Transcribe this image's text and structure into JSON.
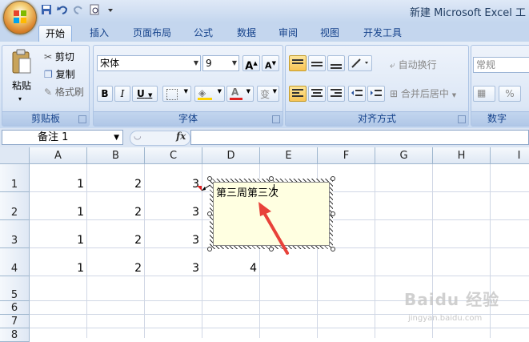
{
  "app": {
    "title": "新建 Microsoft Excel 工"
  },
  "tabs": [
    {
      "label": "开始",
      "active": true
    },
    {
      "label": "插入"
    },
    {
      "label": "页面布局"
    },
    {
      "label": "公式"
    },
    {
      "label": "数据"
    },
    {
      "label": "审阅"
    },
    {
      "label": "视图"
    },
    {
      "label": "开发工具"
    }
  ],
  "ribbon": {
    "clipboard": {
      "label": "剪贴板",
      "paste": "粘贴",
      "cut": "剪切",
      "copy": "复制",
      "format_painter": "格式刷"
    },
    "font": {
      "label": "字体",
      "font_name": "宋体",
      "font_size": "9",
      "bold": "B",
      "italic": "I",
      "underline": "U",
      "grow": "A",
      "shrink": "A",
      "color_a": "A",
      "phonetic": "变"
    },
    "alignment": {
      "label": "对齐方式",
      "wrap_text": "自动换行",
      "merge_center": "合并后居中"
    },
    "number": {
      "label": "数字",
      "format": "常规",
      "percent": "%"
    }
  },
  "formula_bar": {
    "name_box": "备注 1",
    "fx": "fx",
    "value": ""
  },
  "columns": [
    "A",
    "B",
    "C",
    "D",
    "E",
    "F",
    "G",
    "H",
    "I"
  ],
  "rows": [
    "1",
    "2",
    "3",
    "4",
    "5",
    "6",
    "7",
    "8"
  ],
  "cells": {
    "A1": "1",
    "B1": "2",
    "C1": "3",
    "A2": "1",
    "B2": "2",
    "C2": "3",
    "A3": "1",
    "B3": "2",
    "C3": "3",
    "A4": "1",
    "B4": "2",
    "C4": "3",
    "D4": "4"
  },
  "comment": {
    "text": "第三周第三次"
  },
  "colors": {
    "arrow": "#e8423a",
    "comment_bg": "#ffffe1",
    "indicator": "#e02020"
  },
  "watermark": {
    "text": "Baidu 经验",
    "sub": "jingyan.baidu.com"
  }
}
